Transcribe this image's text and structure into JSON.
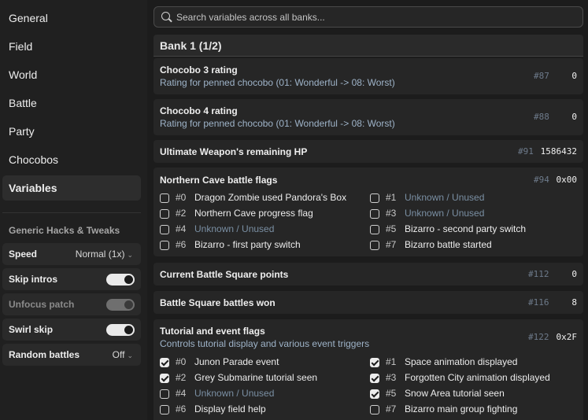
{
  "sidebar": {
    "nav": [
      "General",
      "Field",
      "World",
      "Battle",
      "Party",
      "Chocobos",
      "Variables"
    ],
    "active": "Variables",
    "section_title": "Generic Hacks & Tweaks",
    "controls": {
      "speed": {
        "label": "Speed",
        "value": "Normal (1x)"
      },
      "skip_intros": {
        "label": "Skip intros",
        "on": true
      },
      "unfocus_patch": {
        "label": "Unfocus patch",
        "on": true,
        "disabled": true
      },
      "swirl_skip": {
        "label": "Swirl skip",
        "on": true
      },
      "random_battles": {
        "label": "Random battles",
        "value": "Off"
      }
    }
  },
  "main": {
    "search_placeholder": "Search variables across all banks...",
    "bank_title": "Bank 1 (1/2)",
    "vars": [
      {
        "title": "Chocobo 3 rating",
        "desc": "Rating for penned chocobo (01: Wonderful -> 08: Worst)",
        "addr": "#87",
        "value": "0"
      },
      {
        "title": "Chocobo 4 rating",
        "desc": "Rating for penned chocobo (01: Wonderful -> 08: Worst)",
        "addr": "#88",
        "value": "0"
      },
      {
        "title": "Ultimate Weapon's remaining HP",
        "addr": "#91",
        "value": "1586432"
      },
      {
        "title": "Northern Cave battle flags",
        "addr": "#94",
        "value": "0x00",
        "flags": [
          {
            "num": "#0",
            "label": "Dragon Zombie used Pandora's Box",
            "checked": false
          },
          {
            "num": "#1",
            "label": "Unknown / Unused",
            "checked": false,
            "unused": true
          },
          {
            "num": "#2",
            "label": "Northern Cave progress flag",
            "checked": false
          },
          {
            "num": "#3",
            "label": "Unknown / Unused",
            "checked": false,
            "unused": true
          },
          {
            "num": "#4",
            "label": "Unknown / Unused",
            "checked": false,
            "unused": true
          },
          {
            "num": "#5",
            "label": "Bizarro - second party switch",
            "checked": false
          },
          {
            "num": "#6",
            "label": "Bizarro - first party switch",
            "checked": false
          },
          {
            "num": "#7",
            "label": "Bizarro battle started",
            "checked": false
          }
        ]
      },
      {
        "title": "Current Battle Square points",
        "addr": "#112",
        "value": "0"
      },
      {
        "title": "Battle Square battles won",
        "addr": "#116",
        "value": "8"
      },
      {
        "title": "Tutorial and event flags",
        "desc": "Controls tutorial display and various event triggers",
        "addr": "#122",
        "value": "0x2F",
        "flags": [
          {
            "num": "#0",
            "label": "Junon Parade event",
            "checked": true
          },
          {
            "num": "#1",
            "label": "Space animation displayed",
            "checked": true
          },
          {
            "num": "#2",
            "label": "Grey Submarine tutorial seen",
            "checked": true
          },
          {
            "num": "#3",
            "label": "Forgotten City animation displayed",
            "checked": true
          },
          {
            "num": "#4",
            "label": "Unknown / Unused",
            "checked": false,
            "unused": true
          },
          {
            "num": "#5",
            "label": "Snow Area tutorial seen",
            "checked": true
          },
          {
            "num": "#6",
            "label": "Display field help",
            "checked": false
          },
          {
            "num": "#7",
            "label": "Bizarro main group fighting",
            "checked": false
          }
        ]
      }
    ]
  }
}
